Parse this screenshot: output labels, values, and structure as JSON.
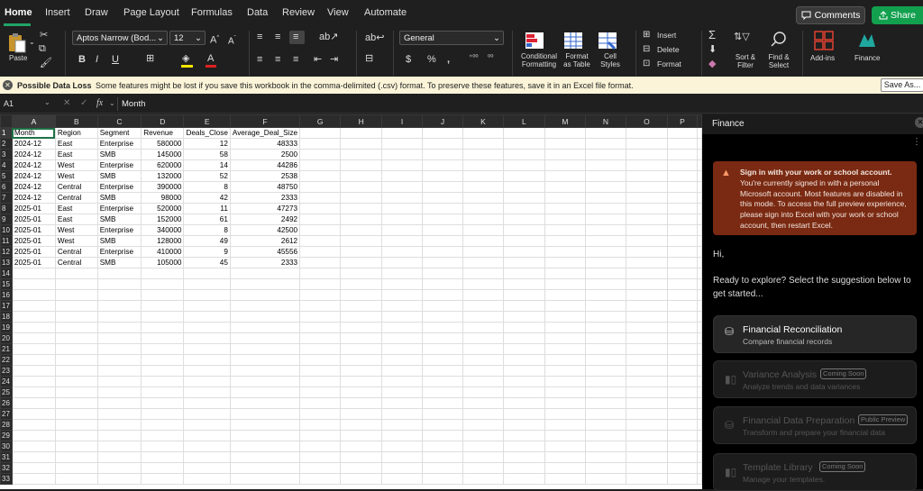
{
  "tabs": [
    "Home",
    "Insert",
    "Draw",
    "Page Layout",
    "Formulas",
    "Data",
    "Review",
    "View",
    "Automate"
  ],
  "top_buttons": {
    "comments": "Comments",
    "share": "Share"
  },
  "ribbon": {
    "paste": "Paste",
    "font_name": "Aptos Narrow (Bod...",
    "font_size": "12",
    "number_format": "General",
    "conditional": [
      "Conditional",
      "Formatting"
    ],
    "format_table": [
      "Format",
      "as Table"
    ],
    "cell_styles": [
      "Cell",
      "Styles"
    ],
    "insert": "Insert",
    "delete": "Delete",
    "format": "Format",
    "sort_filter": [
      "Sort &",
      "Filter"
    ],
    "find_select": [
      "Find &",
      "Select"
    ],
    "addins": "Add-ins",
    "finance": "Finance"
  },
  "message_bar": {
    "title": "Possible Data Loss",
    "body": "Some features might be lost if you save this workbook in the comma-delimited (.csv) format. To preserve these features, save it in an Excel file format.",
    "save_as": "Save As..."
  },
  "formula_bar": {
    "name_box": "A1",
    "fx": "fx",
    "value": "Month"
  },
  "sheet": {
    "columns": [
      "A",
      "B",
      "C",
      "D",
      "E",
      "F",
      "G",
      "H",
      "I",
      "J",
      "K",
      "L",
      "M",
      "N",
      "O",
      "P"
    ],
    "header_row": [
      "Month",
      "Region",
      "Segment",
      "Revenue",
      "Deals_Close",
      "Average_Deal_Size"
    ],
    "rows": [
      [
        "2024-12",
        "East",
        "Enterprise",
        "580000",
        "12",
        "48333"
      ],
      [
        "2024-12",
        "East",
        "SMB",
        "145000",
        "58",
        "2500"
      ],
      [
        "2024-12",
        "West",
        "Enterprise",
        "620000",
        "14",
        "44286"
      ],
      [
        "2024-12",
        "West",
        "SMB",
        "132000",
        "52",
        "2538"
      ],
      [
        "2024-12",
        "Central",
        "Enterprise",
        "390000",
        "8",
        "48750"
      ],
      [
        "2024-12",
        "Central",
        "SMB",
        "98000",
        "42",
        "2333"
      ],
      [
        "2025-01",
        "East",
        "Enterprise",
        "520000",
        "11",
        "47273"
      ],
      [
        "2025-01",
        "East",
        "SMB",
        "152000",
        "61",
        "2492"
      ],
      [
        "2025-01",
        "West",
        "Enterprise",
        "340000",
        "8",
        "42500"
      ],
      [
        "2025-01",
        "West",
        "SMB",
        "128000",
        "49",
        "2612"
      ],
      [
        "2025-01",
        "Central",
        "Enterprise",
        "410000",
        "9",
        "45556"
      ],
      [
        "2025-01",
        "Central",
        "SMB",
        "105000",
        "45",
        "2333"
      ]
    ],
    "row_count": 33
  },
  "pane": {
    "title": "Finance",
    "warning_title": "Sign in with your work or school account.",
    "warning_body": "You're currently signed in with a personal Microsoft account. Most features are disabled in this mode. To access the full preview experience, please sign into Excel with your work or school account, then restart Excel.",
    "greeting": "Hi,",
    "intro": "Ready to explore? Select the suggestion below to get started...",
    "cards": [
      {
        "title": "Financial Reconciliation",
        "subtitle": "Compare financial records",
        "badge": "",
        "enabled": true,
        "icon": "database-icon"
      },
      {
        "title": "Variance Analysis",
        "subtitle": "Analyze trends and data variances",
        "badge": "Coming Soon",
        "enabled": false,
        "icon": "bar-chart-icon"
      },
      {
        "title": "Financial Data Preparation",
        "subtitle": "Transform and prepare your financial data",
        "badge": "Public Preview",
        "enabled": false,
        "icon": "data-prep-icon"
      },
      {
        "title": "Template Library",
        "subtitle": "Manage your templates.",
        "badge": "Coming Soon",
        "enabled": false,
        "icon": "template-icon"
      }
    ]
  },
  "colors": {
    "accent": "#21a366",
    "warning": "#7a2a12",
    "share": "#12a04e"
  }
}
